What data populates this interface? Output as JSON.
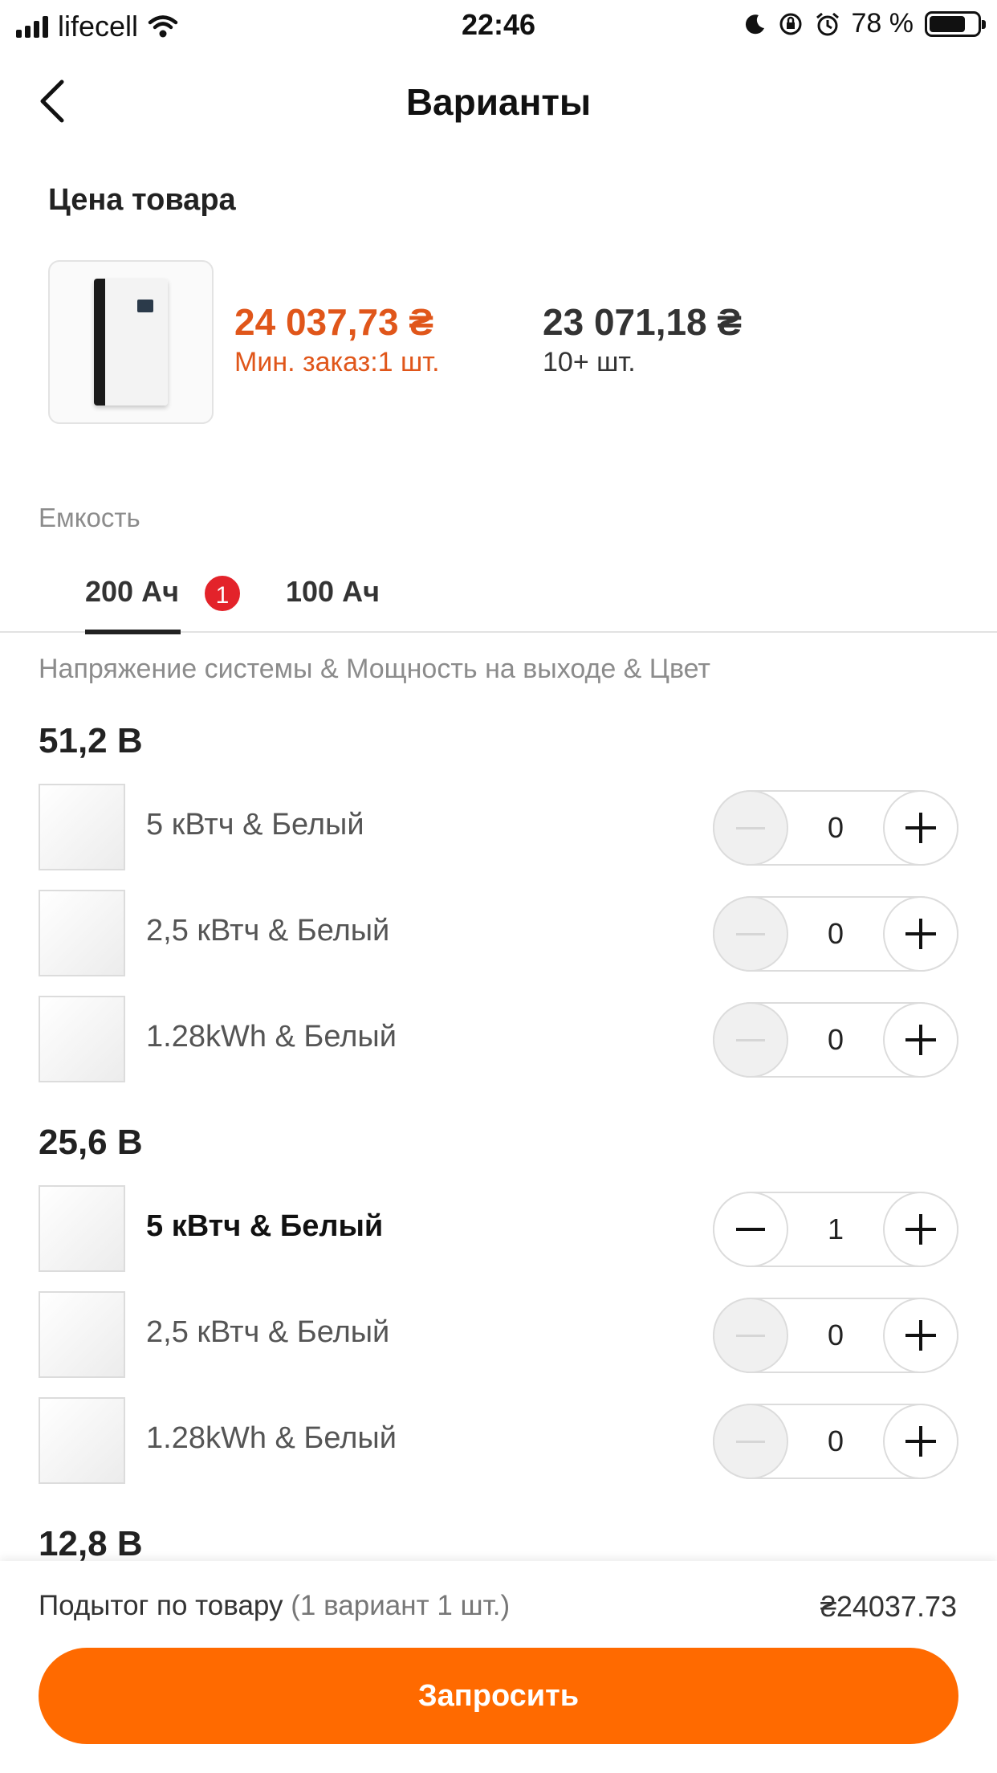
{
  "status_bar": {
    "carrier": "lifecell",
    "time": "22:46",
    "battery": "78 %"
  },
  "header": {
    "title": "Варианты"
  },
  "price": {
    "section_label": "Цена товара",
    "tier1_price": "24 037,73 ₴",
    "tier1_note": "Мин. заказ:1 шт.",
    "tier2_price": "23 071,18 ₴",
    "tier2_note": "10+ шт."
  },
  "capacity": {
    "label": "Емкость",
    "tabs": [
      {
        "label": "200 Ач",
        "badge": "1"
      },
      {
        "label": "100 Ач"
      }
    ]
  },
  "attributes_label": "Напряжение системы & Мощность на выходе & Цвет",
  "groups": [
    {
      "title": "51,2 В",
      "items": [
        {
          "label": "5 кВтч & Белый",
          "qty": "0"
        },
        {
          "label": "2,5 кВтч & Белый",
          "qty": "0"
        },
        {
          "label": "1.28kWh & Белый",
          "qty": "0"
        }
      ]
    },
    {
      "title": "25,6 В",
      "items": [
        {
          "label": "5 кВтч & Белый",
          "qty": "1"
        },
        {
          "label": "2,5 кВтч & Белый",
          "qty": "0"
        },
        {
          "label": "1.28kWh & Белый",
          "qty": "0"
        }
      ]
    },
    {
      "title": "12,8 В",
      "items": []
    }
  ],
  "footer": {
    "subtotal_label": "Подытог по товару",
    "subtotal_note": "(1 вариант 1 шт.)",
    "subtotal_value": "₴24037.73",
    "request_button": "Запросить"
  },
  "colors": {
    "accent": "#ff6a00",
    "price_highlight": "#e0561a",
    "badge": "#e3232a"
  }
}
